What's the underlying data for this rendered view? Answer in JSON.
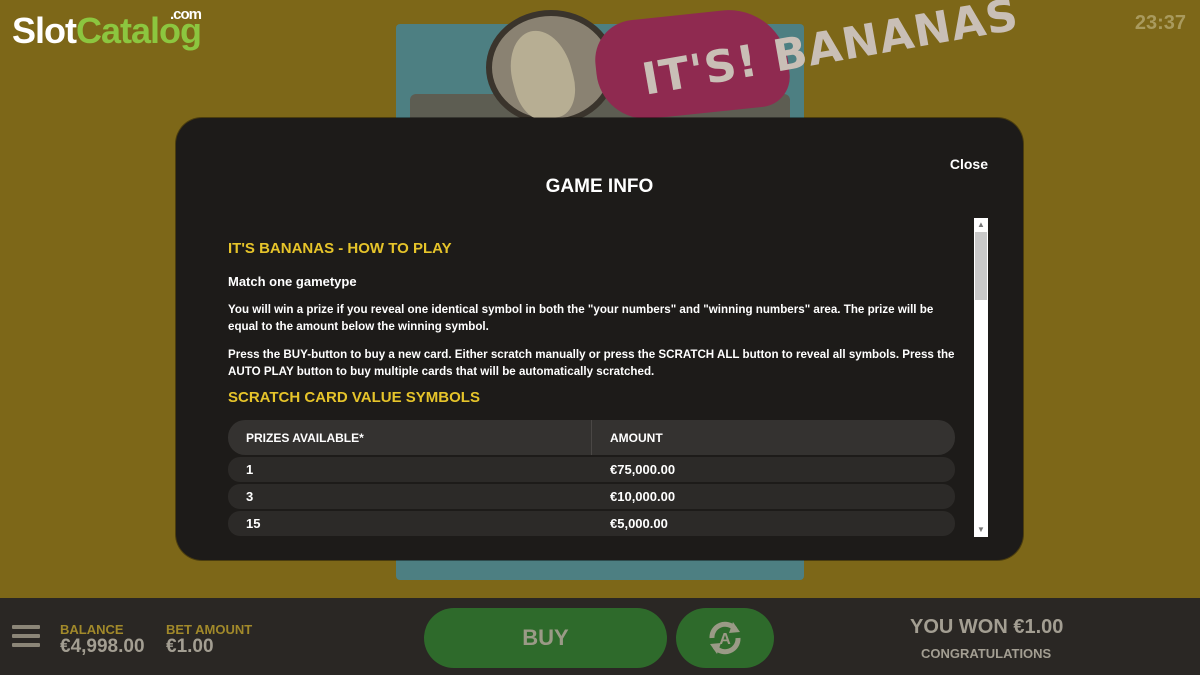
{
  "header": {
    "brand_part1": "Slot",
    "brand_part2": "Catalog",
    "brand_suffix": ".com",
    "clock": "23:37",
    "game_logo": "IT'S! BANANAS"
  },
  "modal": {
    "title": "GAME INFO",
    "close_label": "Close",
    "section1_heading": "IT'S BANANAS - HOW TO PLAY",
    "gametype": "Match one gametype",
    "paragraph1": "You will win a prize if you reveal one identical symbol in both the \"your numbers\" and \"winning numbers\" area. The prize will be equal to the amount below the winning symbol.",
    "paragraph2": "Press the BUY-button to buy a new card. Either scratch manually or press the SCRATCH ALL button to reveal all symbols. Press the AUTO PLAY button to buy multiple cards that will be automatically scratched.",
    "section2_heading": "SCRATCH CARD VALUE SYMBOLS",
    "table": {
      "headers": [
        "PRIZES AVAILABLE*",
        "AMOUNT"
      ],
      "rows": [
        [
          "1",
          "€75,000.00"
        ],
        [
          "3",
          "€10,000.00"
        ],
        [
          "15",
          "€5,000.00"
        ]
      ]
    }
  },
  "bottom_bar": {
    "menu_icon": "hamburger-menu-icon",
    "balance_label": "BALANCE",
    "balance_value": "€4,998.00",
    "bet_label": "BET AMOUNT",
    "bet_value": "€1.00",
    "buy_label": "BUY",
    "autoplay_icon": "autoplay-icon",
    "won_text": "YOU WON €1.00",
    "congrats_text": "CONGRATULATIONS"
  },
  "colors": {
    "accent_yellow": "#e6c42a",
    "brand_green": "#8cc63f",
    "button_green": "#2e6a2b",
    "modal_bg": "#1d1b19"
  }
}
